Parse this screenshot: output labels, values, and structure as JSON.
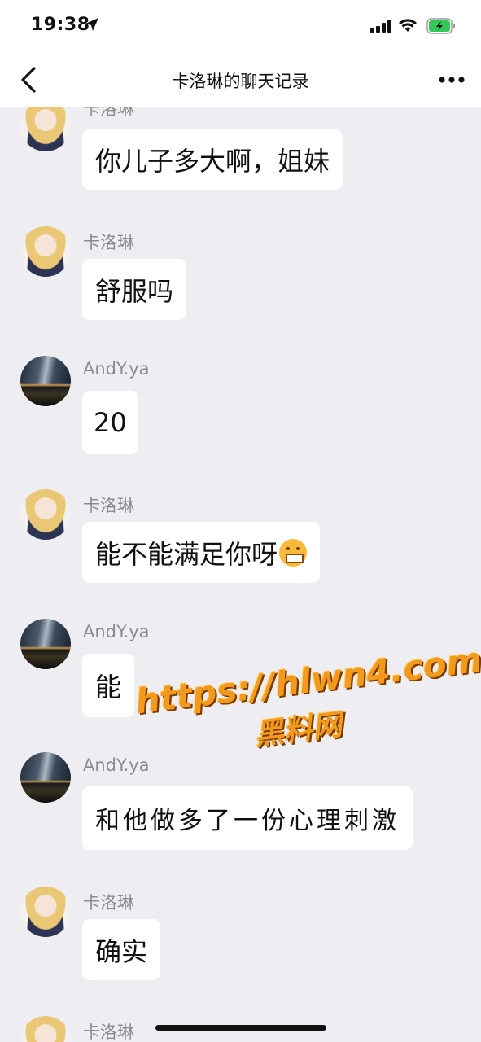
{
  "status_bar": {
    "time": "19:38"
  },
  "nav": {
    "title": "卡洛琳的聊天记录"
  },
  "messages": [
    {
      "sender": "卡洛琳",
      "text": "你儿子多大啊，姐妹",
      "avatar": "caroline-avatar"
    },
    {
      "sender": "卡洛琳",
      "text": "舒服吗",
      "avatar": "caroline-avatar"
    },
    {
      "sender": "AndY.ya",
      "text": "20",
      "avatar": "andy-avatar"
    },
    {
      "sender": "卡洛琳",
      "text": "能不能满足你呀",
      "emoji": "grinning-face-icon",
      "avatar": "caroline-avatar"
    },
    {
      "sender": "AndY.ya",
      "text": "能",
      "avatar": "andy-avatar"
    },
    {
      "sender": "AndY.ya",
      "text": "和他做多了一份心理刺激",
      "avatar": "andy-avatar"
    },
    {
      "sender": "卡洛琳",
      "text": "确实",
      "avatar": "caroline-avatar"
    },
    {
      "sender": "卡洛琳",
      "avatar": "caroline-avatar"
    }
  ],
  "watermark": {
    "url": "https://hlwn4.com",
    "name": "黑料网"
  },
  "colors": {
    "background": "#ededf2",
    "bubble": "#ffffff",
    "sender": "#8c8c8c",
    "watermark": "#f39a1e"
  }
}
